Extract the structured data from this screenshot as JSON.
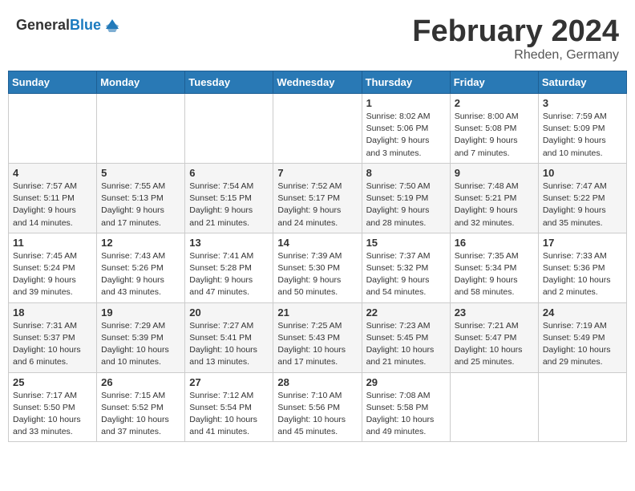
{
  "header": {
    "logo_general": "General",
    "logo_blue": "Blue",
    "month_title": "February 2024",
    "location": "Rheden, Germany"
  },
  "weekdays": [
    "Sunday",
    "Monday",
    "Tuesday",
    "Wednesday",
    "Thursday",
    "Friday",
    "Saturday"
  ],
  "weeks": [
    [
      null,
      null,
      null,
      null,
      {
        "day": "1",
        "sunrise": "8:02 AM",
        "sunset": "5:06 PM",
        "daylight": "9 hours and 3 minutes."
      },
      {
        "day": "2",
        "sunrise": "8:00 AM",
        "sunset": "5:08 PM",
        "daylight": "9 hours and 7 minutes."
      },
      {
        "day": "3",
        "sunrise": "7:59 AM",
        "sunset": "5:09 PM",
        "daylight": "9 hours and 10 minutes."
      }
    ],
    [
      {
        "day": "4",
        "sunrise": "7:57 AM",
        "sunset": "5:11 PM",
        "daylight": "9 hours and 14 minutes."
      },
      {
        "day": "5",
        "sunrise": "7:55 AM",
        "sunset": "5:13 PM",
        "daylight": "9 hours and 17 minutes."
      },
      {
        "day": "6",
        "sunrise": "7:54 AM",
        "sunset": "5:15 PM",
        "daylight": "9 hours and 21 minutes."
      },
      {
        "day": "7",
        "sunrise": "7:52 AM",
        "sunset": "5:17 PM",
        "daylight": "9 hours and 24 minutes."
      },
      {
        "day": "8",
        "sunrise": "7:50 AM",
        "sunset": "5:19 PM",
        "daylight": "9 hours and 28 minutes."
      },
      {
        "day": "9",
        "sunrise": "7:48 AM",
        "sunset": "5:21 PM",
        "daylight": "9 hours and 32 minutes."
      },
      {
        "day": "10",
        "sunrise": "7:47 AM",
        "sunset": "5:22 PM",
        "daylight": "9 hours and 35 minutes."
      }
    ],
    [
      {
        "day": "11",
        "sunrise": "7:45 AM",
        "sunset": "5:24 PM",
        "daylight": "9 hours and 39 minutes."
      },
      {
        "day": "12",
        "sunrise": "7:43 AM",
        "sunset": "5:26 PM",
        "daylight": "9 hours and 43 minutes."
      },
      {
        "day": "13",
        "sunrise": "7:41 AM",
        "sunset": "5:28 PM",
        "daylight": "9 hours and 47 minutes."
      },
      {
        "day": "14",
        "sunrise": "7:39 AM",
        "sunset": "5:30 PM",
        "daylight": "9 hours and 50 minutes."
      },
      {
        "day": "15",
        "sunrise": "7:37 AM",
        "sunset": "5:32 PM",
        "daylight": "9 hours and 54 minutes."
      },
      {
        "day": "16",
        "sunrise": "7:35 AM",
        "sunset": "5:34 PM",
        "daylight": "9 hours and 58 minutes."
      },
      {
        "day": "17",
        "sunrise": "7:33 AM",
        "sunset": "5:36 PM",
        "daylight": "10 hours and 2 minutes."
      }
    ],
    [
      {
        "day": "18",
        "sunrise": "7:31 AM",
        "sunset": "5:37 PM",
        "daylight": "10 hours and 6 minutes."
      },
      {
        "day": "19",
        "sunrise": "7:29 AM",
        "sunset": "5:39 PM",
        "daylight": "10 hours and 10 minutes."
      },
      {
        "day": "20",
        "sunrise": "7:27 AM",
        "sunset": "5:41 PM",
        "daylight": "10 hours and 13 minutes."
      },
      {
        "day": "21",
        "sunrise": "7:25 AM",
        "sunset": "5:43 PM",
        "daylight": "10 hours and 17 minutes."
      },
      {
        "day": "22",
        "sunrise": "7:23 AM",
        "sunset": "5:45 PM",
        "daylight": "10 hours and 21 minutes."
      },
      {
        "day": "23",
        "sunrise": "7:21 AM",
        "sunset": "5:47 PM",
        "daylight": "10 hours and 25 minutes."
      },
      {
        "day": "24",
        "sunrise": "7:19 AM",
        "sunset": "5:49 PM",
        "daylight": "10 hours and 29 minutes."
      }
    ],
    [
      {
        "day": "25",
        "sunrise": "7:17 AM",
        "sunset": "5:50 PM",
        "daylight": "10 hours and 33 minutes."
      },
      {
        "day": "26",
        "sunrise": "7:15 AM",
        "sunset": "5:52 PM",
        "daylight": "10 hours and 37 minutes."
      },
      {
        "day": "27",
        "sunrise": "7:12 AM",
        "sunset": "5:54 PM",
        "daylight": "10 hours and 41 minutes."
      },
      {
        "day": "28",
        "sunrise": "7:10 AM",
        "sunset": "5:56 PM",
        "daylight": "10 hours and 45 minutes."
      },
      {
        "day": "29",
        "sunrise": "7:08 AM",
        "sunset": "5:58 PM",
        "daylight": "10 hours and 49 minutes."
      },
      null,
      null
    ]
  ]
}
